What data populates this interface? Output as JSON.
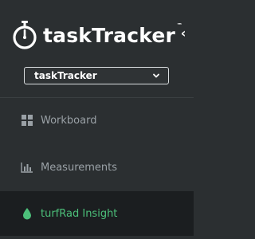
{
  "brand": {
    "name": "taskTracker",
    "trademark": "™"
  },
  "collapse": {
    "glyph": "‹"
  },
  "project_select": {
    "value": "taskTracker"
  },
  "nav": {
    "items": [
      {
        "label": "Workboard",
        "icon": "grid-icon",
        "active": false
      },
      {
        "label": "Measurements",
        "icon": "bar-chart-icon",
        "active": false
      },
      {
        "label": "turfRad Insight",
        "icon": "droplet-icon",
        "active": true
      }
    ]
  },
  "colors": {
    "background": "#2b2f31",
    "active_background": "#1b1e20",
    "accent": "#4cc07a",
    "nav_text": "#9aa1a6"
  }
}
